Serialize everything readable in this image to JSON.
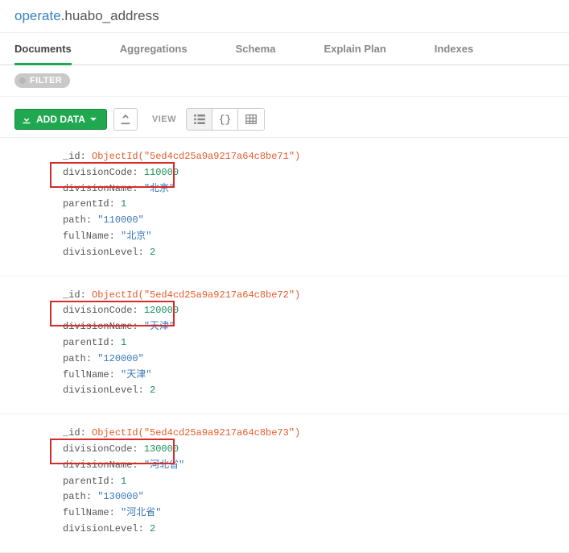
{
  "breadcrumb": {
    "database": "operate",
    "collection": ".huabo_address"
  },
  "tabs": [
    {
      "label": "Documents",
      "active": true
    },
    {
      "label": "Aggregations",
      "active": false
    },
    {
      "label": "Schema",
      "active": false
    },
    {
      "label": "Explain Plan",
      "active": false
    },
    {
      "label": "Indexes",
      "active": false
    }
  ],
  "filter": {
    "label": "FILTER"
  },
  "toolbar": {
    "add_data_label": "ADD DATA",
    "view_label": "VIEW"
  },
  "documents": [
    {
      "_id": "ObjectId(\"5ed4cd25a9a9217a64c8be71\")",
      "divisionCode": "110000",
      "divisionName": "\"北京\"",
      "parentId": "1",
      "path": "\"110000\"",
      "fullName": "\"北京\"",
      "divisionLevel": "2"
    },
    {
      "_id": "ObjectId(\"5ed4cd25a9a9217a64c8be72\")",
      "divisionCode": "120000",
      "divisionName": "\"天津\"",
      "parentId": "1",
      "path": "\"120000\"",
      "fullName": "\"天津\"",
      "divisionLevel": "2"
    },
    {
      "_id": "ObjectId(\"5ed4cd25a9a9217a64c8be73\")",
      "divisionCode": "130000",
      "divisionName": "\"河北省\"",
      "parentId": "1",
      "path": "\"130000\"",
      "fullName": "\"河北省\"",
      "divisionLevel": "2"
    }
  ]
}
